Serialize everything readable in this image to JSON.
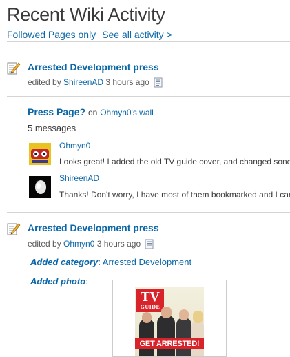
{
  "header": {
    "title": "Recent Wiki Activity"
  },
  "tabs": [
    {
      "label": "Followed Pages only"
    },
    {
      "label": "See all activity >"
    }
  ],
  "activities": [
    {
      "title": "Arrested Development press",
      "edited_by": "edited by",
      "user": "ShireenAD",
      "time": "3 hours ago"
    },
    {
      "title": "Arrested Development press",
      "edited_by": "edited by",
      "user": "Ohmyn0",
      "time": "3 hours ago"
    }
  ],
  "wall": {
    "title": "Press Page?",
    "on": "on",
    "wall_link": "Ohmyn0's wall",
    "count": "5 messages",
    "messages": [
      {
        "user": "Ohmyn0",
        "text": "Looks great! I added the old TV guide cover, and changed sone"
      },
      {
        "user": "ShireenAD",
        "text": "Thanks! Don't worry, I have most of them bookmarked and I can"
      }
    ]
  },
  "details": {
    "category_label": "Added category",
    "category_value": "Arrested Development",
    "photo_label": "Added photo",
    "colon": ":"
  },
  "photo": {
    "logo_line1": "TV",
    "logo_line2": "GUIDE",
    "banner": "GET ARRESTED!"
  },
  "colors": {
    "link": "#0b67a8",
    "text": "#3a3a3a",
    "divider": "#d4d4d4",
    "tv_red": "#d9232a"
  }
}
